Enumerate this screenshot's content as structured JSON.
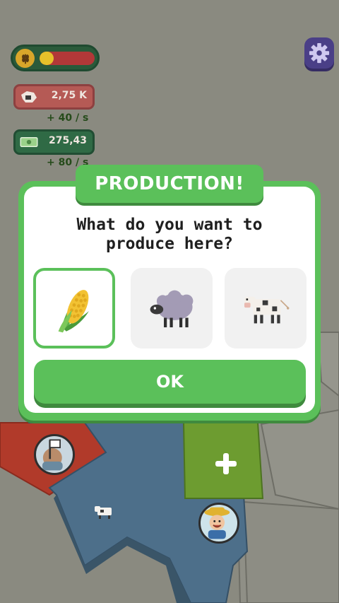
{
  "hud": {
    "wheat_icon": "wheat-icon",
    "wheat_level": 0.25,
    "meat_value": "2,75 K",
    "meat_rate": "+ 40 / s",
    "money_value": "275,43",
    "money_rate": "+ 80 / s",
    "settings_icon": "gear-icon"
  },
  "dialog": {
    "title": "PRODUCTION!",
    "question_line1": "What do you want to",
    "question_line2": "produce here?",
    "options": [
      {
        "name": "corn",
        "icon": "corn-icon",
        "selected": true
      },
      {
        "name": "sheep",
        "icon": "sheep-icon",
        "selected": false
      },
      {
        "name": "cow",
        "icon": "cow-icon",
        "selected": false
      }
    ],
    "ok_label": "OK"
  },
  "map": {
    "plus_icon": "plus-icon",
    "colors": {
      "red_region": "#b13a2a",
      "blue_region": "#4d6f8a",
      "green_region": "#6d9c30",
      "gray_region": "#8f8f86"
    }
  },
  "colors": {
    "accent_green": "#5bc05a",
    "settings_purple": "#4a3f87"
  }
}
